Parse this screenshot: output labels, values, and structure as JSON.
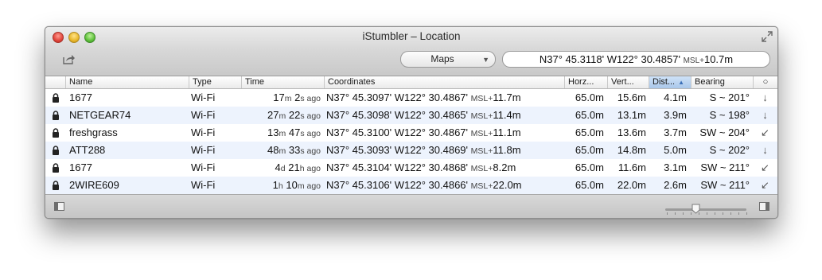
{
  "window": {
    "title": "iStumbler – Location"
  },
  "toolbar": {
    "popup_value": "Maps",
    "location": {
      "lat": "N37° 45.3118'",
      "lon": "W122° 30.4857'",
      "msl_label": "MSL+",
      "alt": "10.7m"
    }
  },
  "table": {
    "columns": [
      "Name",
      "Type",
      "Time",
      "Coordinates",
      "Horz...",
      "Vert...",
      "Dist...",
      "Bearing",
      "○"
    ],
    "sorted_column": "Dist...",
    "rows": [
      {
        "name": "1677",
        "type": "Wi-Fi",
        "t1": "17",
        "u1": "m",
        "t2": "2",
        "u2": "s ago",
        "lat": "N37° 45.3097'",
        "lon": "W122° 30.4867'",
        "msl": "MSL+",
        "alt": "11.7m",
        "horz": "65.0m",
        "vert": "15.6m",
        "dist": "4.1m",
        "bearing": "S ~ 201°",
        "dir": "↓"
      },
      {
        "name": "NETGEAR74",
        "type": "Wi-Fi",
        "t1": "27",
        "u1": "m",
        "t2": "22",
        "u2": "s ago",
        "lat": "N37° 45.3098'",
        "lon": "W122° 30.4865'",
        "msl": "MSL+",
        "alt": "11.4m",
        "horz": "65.0m",
        "vert": "13.1m",
        "dist": "3.9m",
        "bearing": "S ~ 198°",
        "dir": "↓"
      },
      {
        "name": "freshgrass",
        "type": "Wi-Fi",
        "t1": "13",
        "u1": "m",
        "t2": "47",
        "u2": "s ago",
        "lat": "N37° 45.3100'",
        "lon": "W122° 30.4867'",
        "msl": "MSL+",
        "alt": "11.1m",
        "horz": "65.0m",
        "vert": "13.6m",
        "dist": "3.7m",
        "bearing": "SW ~ 204°",
        "dir": "↙"
      },
      {
        "name": "ATT288",
        "type": "Wi-Fi",
        "t1": "48",
        "u1": "m",
        "t2": "33",
        "u2": "s ago",
        "lat": "N37° 45.3093'",
        "lon": "W122° 30.4869'",
        "msl": "MSL+",
        "alt": "11.8m",
        "horz": "65.0m",
        "vert": "14.8m",
        "dist": "5.0m",
        "bearing": "S ~ 202°",
        "dir": "↓"
      },
      {
        "name": "1677",
        "type": "Wi-Fi",
        "t1": "4",
        "u1": "d",
        "t2": "21",
        "u2": "h ago",
        "lat": "N37° 45.3104'",
        "lon": "W122° 30.4868'",
        "msl": "MSL+",
        "alt": "8.2m",
        "horz": "65.0m",
        "vert": "11.6m",
        "dist": "3.1m",
        "bearing": "SW ~ 211°",
        "dir": "↙"
      },
      {
        "name": "2WIRE609",
        "type": "Wi-Fi",
        "t1": "1",
        "u1": "h",
        "t2": "10",
        "u2": "m ago",
        "lat": "N37° 45.3106'",
        "lon": "W122° 30.4866'",
        "msl": "MSL+",
        "alt": "22.0m",
        "horz": "65.0m",
        "vert": "22.0m",
        "dist": "2.6m",
        "bearing": "SW ~ 211°",
        "dir": "↙"
      }
    ]
  },
  "bottombar": {
    "zoom_slider_level": 0.38
  },
  "colors": {
    "alt_row": "#edf3fd",
    "sorted_header": "#a9c7ea"
  },
  "icons": [
    "lock-icon",
    "share-icon",
    "fullscreen-icon",
    "sidebar-icon"
  ]
}
